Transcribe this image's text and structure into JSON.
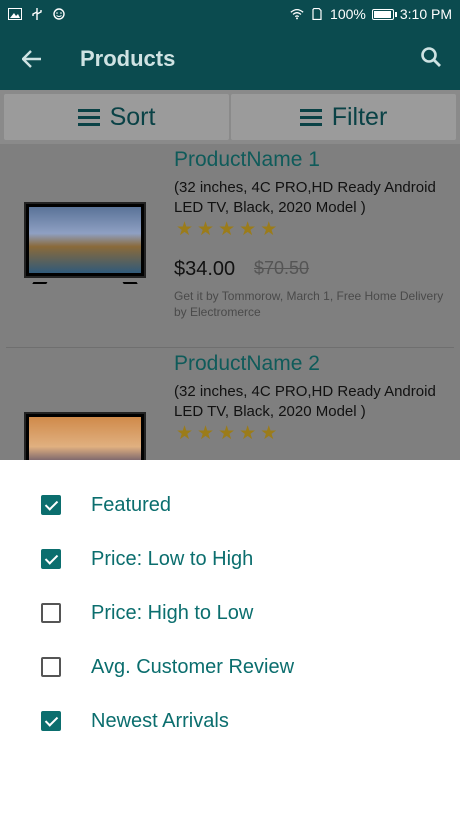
{
  "status_bar": {
    "battery": "100%",
    "time": "3:10 PM",
    "icons": [
      "image-icon",
      "usb-icon",
      "face-icon",
      "wifi-icon",
      "sim-icon",
      "battery-icon"
    ]
  },
  "app_bar": {
    "title": "Products",
    "back_icon": "arrow-left-icon",
    "search_icon": "search-icon",
    "color": "#0b4b4f"
  },
  "sort_filter": {
    "sort_label": "Sort",
    "filter_label": "Filter"
  },
  "products": [
    {
      "name": "ProductName 1",
      "description": "(32 inches, 4C PRO,HD Ready Android LED TV, Black, 2020 Model )",
      "rating": 5,
      "price": "$34.00",
      "old_price": "$70.50",
      "delivery": "Get it by Tommorow, March 1, Free Home Delivery by Electromerce"
    },
    {
      "name": "ProductName 2",
      "description": "(32 inches, 4C PRO,HD Ready Android LED TV, Black, 2020 Model )",
      "rating": 5
    }
  ],
  "sort_options": [
    {
      "label": "Featured",
      "checked": true
    },
    {
      "label": "Price: Low to High",
      "checked": true
    },
    {
      "label": "Price: High to Low",
      "checked": false
    },
    {
      "label": "Avg. Customer Review",
      "checked": false
    },
    {
      "label": "Newest Arrivals",
      "checked": true
    }
  ],
  "colors": {
    "accent": "#0b6e6e",
    "star": "#f4b400"
  }
}
